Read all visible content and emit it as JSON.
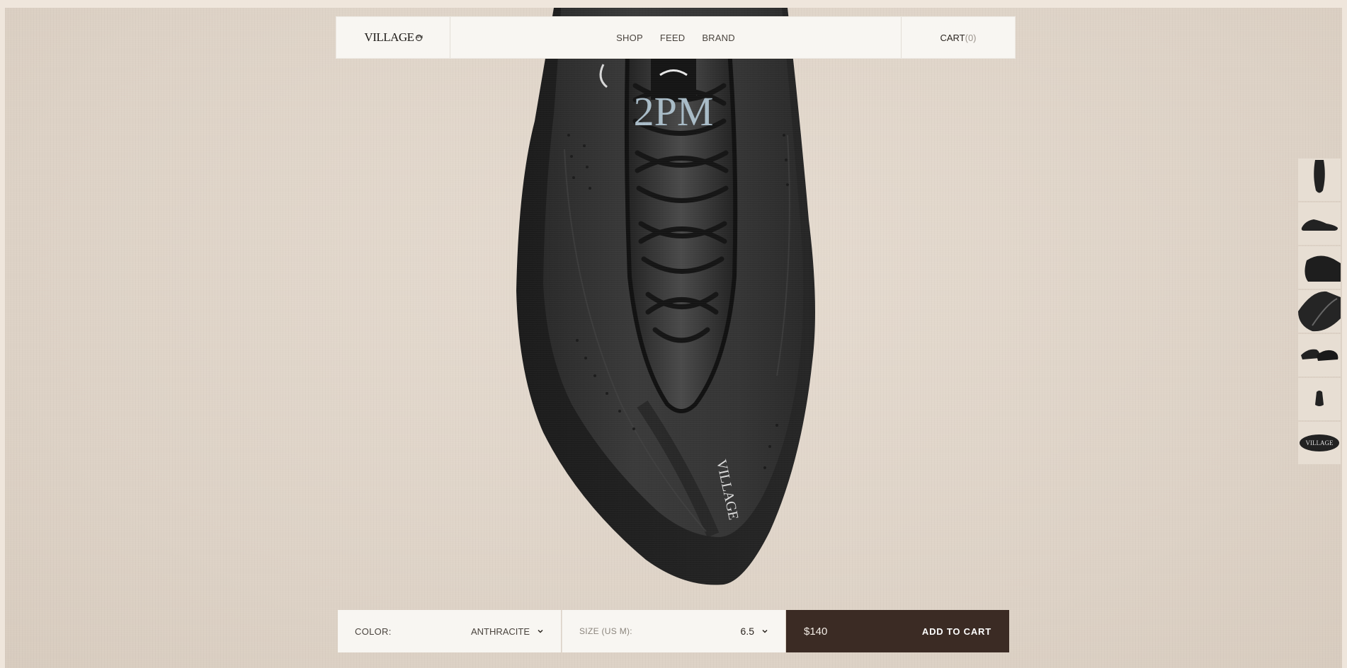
{
  "nav": {
    "logo_text": "VILLAGE",
    "logo_badge": "2PM",
    "links": [
      "SHOP",
      "FEED",
      "BRAND"
    ],
    "cart_label": "CART",
    "cart_count": "(0)"
  },
  "product": {
    "tongue_label": "2PM",
    "side_logo": "VILLAGE",
    "thumbnails": [
      "top-view",
      "side-profile",
      "heel-view",
      "detail-view",
      "pair-view",
      "back-view",
      "logo-closeup"
    ]
  },
  "purchase": {
    "color_label": "COLOR:",
    "color_value": "ANTHRACITE",
    "size_label": "SIZE (US M):",
    "size_value": "6.5",
    "price": "$140",
    "add_to_cart": "ADD TO CART"
  },
  "colors": {
    "background": "#ddd2c6",
    "nav_bg": "#f8f6f2",
    "cart_button": "#3b2b24"
  }
}
